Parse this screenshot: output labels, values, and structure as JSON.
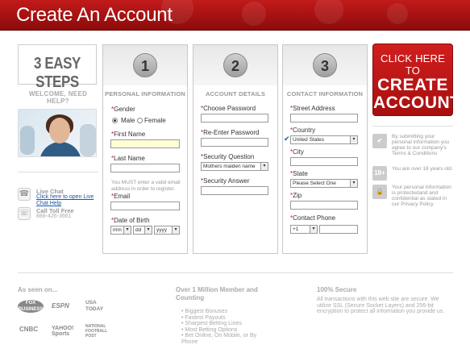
{
  "header": {
    "title": "Create An Account"
  },
  "left": {
    "steps_label": "3 EASY STEPS",
    "welcome": "WELCOME, NEED HELP?",
    "live_chat": {
      "title": "Live Chat",
      "link": "Click here to open Live Chat Help",
      "icon": "chat-icon"
    },
    "toll_free": {
      "title": "Call Toll Free",
      "number": "888-426-3661",
      "icon": "phone-icon"
    }
  },
  "step1": {
    "number": "1",
    "title": "PERSONAL INFORMATION",
    "gender_label": "Gender",
    "gender_options": [
      "Male",
      "Female"
    ],
    "gender_selected": "Male",
    "first_name_label": "First Name",
    "first_name_value": "",
    "last_name_label": "Last Name",
    "last_name_value": "",
    "email_note": "You MUST enter a valid email address in order to register.",
    "email_label": "Email",
    "email_value": "",
    "dob_label": "Date of Birth",
    "dob_month": "mm",
    "dob_day": "dd",
    "dob_year": "yyyy"
  },
  "step2": {
    "number": "2",
    "title": "ACCOUNT DETAILS",
    "password_label": "Choose Password",
    "reenter_label": "Re-Enter Password",
    "security_question_label": "Security Question",
    "security_question_value": "Mothers maiden name",
    "security_answer_label": "Security Answer"
  },
  "step3": {
    "number": "3",
    "title": "CONTACT INFORMATION",
    "street_label": "Street Address",
    "country_label": "Country",
    "country_value": "United States",
    "city_label": "City",
    "state_label": "State",
    "state_value": "Please Select One",
    "zip_label": "Zip",
    "phone_label": "Contact Phone",
    "phone_code": "+1"
  },
  "cta": {
    "line1": "CLICK HERE TO",
    "line2": "CREATE",
    "line3": "ACCOUNT"
  },
  "trust": [
    {
      "icon": "check-icon",
      "text": "By submitting your personal information you agree to our company's Terms & Conditions"
    },
    {
      "icon": "18-plus-icon",
      "text": "You are over 18 years old."
    },
    {
      "icon": "lock-icon",
      "text": "Your personal information is protectedand and confidential as stated in our Privacy Policy"
    }
  ],
  "footer": {
    "seen_on": "As seen on...",
    "logos": [
      "FOX BUSINESS",
      "ESPN",
      "USA TODAY",
      "CNBC",
      "YAHOO! Sports",
      "NATIONAL FOOTBALL POST"
    ],
    "members_title": "Over 1 Million Member and Counting",
    "members_list": [
      "Biggest Bonuses",
      "Fastest Payouts",
      "Sharpest Betting Lines",
      "Most Betting Options",
      "Bet Online, On Mobile, or By Phone"
    ],
    "secure_title": "100% Secure",
    "secure_text": "All transactions with this web site are secure. We utilize SSL (Secure Socket Layers) and 256-bit encryption to protect all information you provide us."
  },
  "colors": {
    "brand_red": "#c21a1a",
    "dark_red": "#8d0b0b"
  }
}
